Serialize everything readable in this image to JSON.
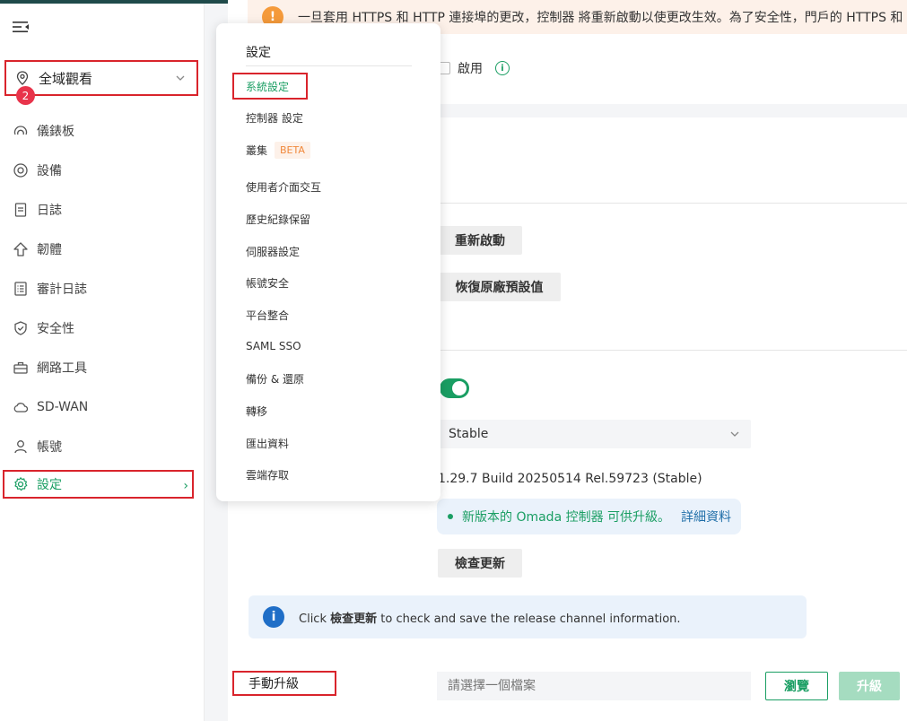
{
  "sidebar": {
    "site_selector": "全域觀看",
    "items": [
      {
        "label": "儀錶板",
        "icon": "dashboard-icon"
      },
      {
        "label": "設備",
        "icon": "devices-icon"
      },
      {
        "label": "日誌",
        "icon": "log-icon"
      },
      {
        "label": "韌體",
        "icon": "firmware-icon"
      },
      {
        "label": "審計日誌",
        "icon": "audit-log-icon"
      },
      {
        "label": "安全性",
        "icon": "shield-icon"
      },
      {
        "label": "網路工具",
        "icon": "toolbox-icon"
      },
      {
        "label": "SD-WAN",
        "icon": "cloud-icon"
      },
      {
        "label": "帳號",
        "icon": "user-icon"
      },
      {
        "label": "設定",
        "icon": "gear-icon"
      }
    ],
    "log_badge": "2",
    "arrow": "›"
  },
  "main": {
    "warning_text": "一旦套用 HTTPS 和 HTTP 連接埠的更改，控制器 將重新啟動以使更改生效。為了安全性，門戶的 HTTPS 和",
    "warning_icon_glyph": "!",
    "enable_label": "啟用",
    "info_icon_glyph": "i",
    "restart_button": "重新啟動",
    "factory_reset_button": "恢復原廠預設值",
    "release_channel": "Stable",
    "version_text": "1.29.7 Build 20250514 Rel.59723 (Stable)",
    "update_message": "新版本的 Omada 控制器 可供升級。",
    "update_details_link": "詳細資料",
    "check_update_button": "檢查更新",
    "info_box": {
      "prefix": "Click ",
      "bold": "檢查更新",
      "suffix": " to check and save the release channel information.",
      "icon_glyph": "i"
    },
    "manual_upgrade_label": "手動升級",
    "file_placeholder": "請選擇一個檔案",
    "browse_button": "瀏覽",
    "upgrade_button": "升級"
  },
  "menu": {
    "title": "設定",
    "items": [
      {
        "label": "系統設定"
      },
      {
        "label": "控制器 設定"
      },
      {
        "label": "叢集",
        "badge": "BETA"
      },
      {
        "label": "使用者介面交互"
      },
      {
        "label": "歷史紀錄保留"
      },
      {
        "label": "伺服器設定"
      },
      {
        "label": "帳號安全"
      },
      {
        "label": "平台整合"
      },
      {
        "label": "SAML SSO"
      },
      {
        "label": "備份 & 還原"
      },
      {
        "label": "轉移"
      },
      {
        "label": "匯出資料"
      },
      {
        "label": "雲端存取"
      }
    ]
  },
  "colors": {
    "accent_green": "#1a9e63",
    "highlight_red": "#d9242c",
    "badge_red": "#e8344b",
    "warning_orange": "#f59a3a",
    "info_blue": "#1f6ec7"
  }
}
